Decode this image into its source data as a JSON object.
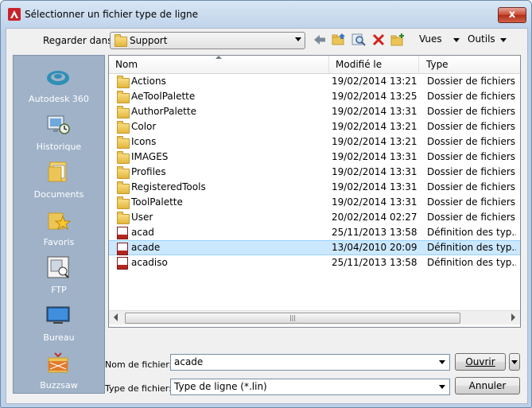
{
  "window": {
    "title": "Sélectionner un fichier type de ligne",
    "close_label": "x"
  },
  "toolbar": {
    "lookin_label": "Regarder dans:",
    "lookin_value": "Support",
    "views_label": "Vues",
    "tools_label": "Outils"
  },
  "places": [
    {
      "label": "Autodesk 360",
      "icon": "cloud-icon"
    },
    {
      "label": "Historique",
      "icon": "history-icon"
    },
    {
      "label": "Documents",
      "icon": "documents-icon"
    },
    {
      "label": "Favoris",
      "icon": "favorites-icon"
    },
    {
      "label": "FTP",
      "icon": "ftp-icon"
    },
    {
      "label": "Bureau",
      "icon": "desktop-icon"
    },
    {
      "label": "Buzzsaw",
      "icon": "buzzsaw-icon"
    }
  ],
  "list": {
    "columns": {
      "name": "Nom",
      "date": "Modifié le",
      "type": "Type"
    },
    "rows": [
      {
        "name": "Actions",
        "date": "19/02/2014 13:21",
        "type": "Dossier de fichiers",
        "kind": "folder"
      },
      {
        "name": "AeToolPalette",
        "date": "19/02/2014 13:25",
        "type": "Dossier de fichiers",
        "kind": "folder"
      },
      {
        "name": "AuthorPalette",
        "date": "19/02/2014 13:31",
        "type": "Dossier de fichiers",
        "kind": "folder"
      },
      {
        "name": "Color",
        "date": "19/02/2014 13:21",
        "type": "Dossier de fichiers",
        "kind": "folder"
      },
      {
        "name": "Icons",
        "date": "19/02/2014 13:21",
        "type": "Dossier de fichiers",
        "kind": "folder"
      },
      {
        "name": "IMAGES",
        "date": "19/02/2014 13:31",
        "type": "Dossier de fichiers",
        "kind": "folder"
      },
      {
        "name": "Profiles",
        "date": "19/02/2014 13:31",
        "type": "Dossier de fichiers",
        "kind": "folder"
      },
      {
        "name": "RegisteredTools",
        "date": "19/02/2014 13:31",
        "type": "Dossier de fichiers",
        "kind": "folder"
      },
      {
        "name": "ToolPalette",
        "date": "19/02/2014 13:31",
        "type": "Dossier de fichiers",
        "kind": "folder"
      },
      {
        "name": "User",
        "date": "20/02/2014 02:27",
        "type": "Dossier de fichiers",
        "kind": "folder"
      },
      {
        "name": "acad",
        "date": "25/11/2013 13:58",
        "type": "Définition des typ...",
        "kind": "file"
      },
      {
        "name": "acade",
        "date": "13/04/2010 20:09",
        "type": "Définition des typ...",
        "kind": "file",
        "selected": true
      },
      {
        "name": "acadiso",
        "date": "25/11/2013 13:58",
        "type": "Définition des typ...",
        "kind": "file"
      }
    ]
  },
  "footer": {
    "filename_label": "Nom de fichier:",
    "filename_value": "acade",
    "filetype_label": "Type de fichier:",
    "filetype_value": "Type de ligne (*.lin)",
    "open_label": "Ouvrir",
    "cancel_label": "Annuler"
  },
  "colors": {
    "accent": "#cce8ff",
    "places_bg": "#9fb2c8",
    "title_bg": "#c3d6ec"
  }
}
